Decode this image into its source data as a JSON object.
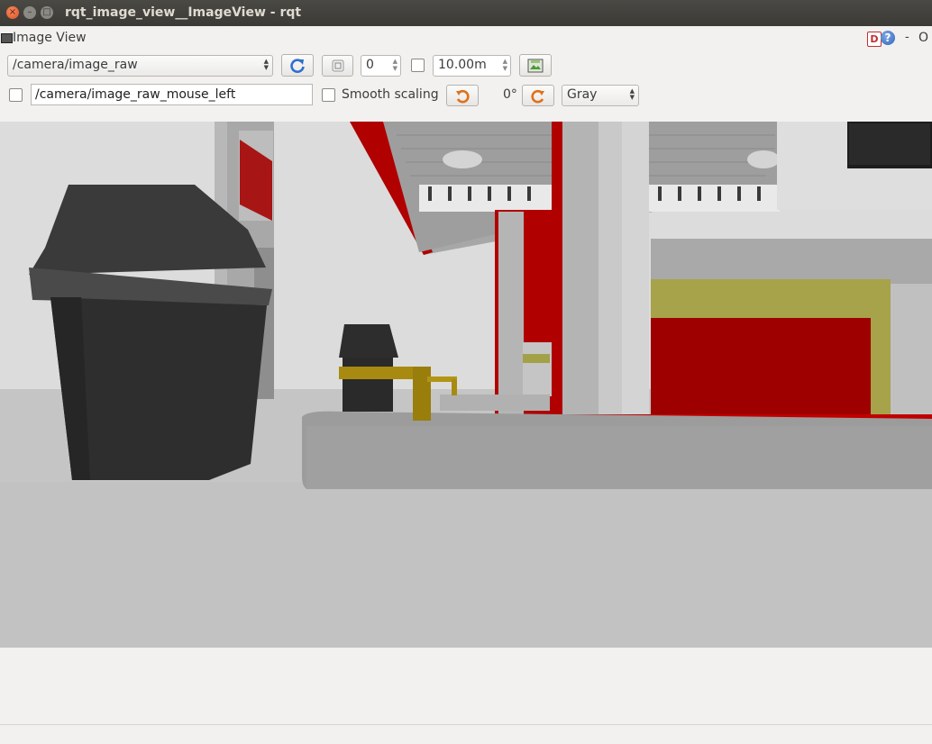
{
  "window": {
    "title": "rqt_image_view__ImageView - rqt"
  },
  "plugin": {
    "title": "Image View",
    "help_letter": "D",
    "help_mark": "?",
    "dash": "-",
    "close": "O"
  },
  "toolbar": {
    "topic": "/camera/image_raw",
    "frame_value": "0",
    "timeout_value": "10.00m",
    "mouse_topic": "/camera/image_raw_mouse_left",
    "smooth_scaling_label": "Smooth scaling",
    "rotation_value": "0°",
    "color_scheme": "Gray"
  },
  "icons": {
    "refresh": "refresh-icon",
    "zoom": "zoom-fit-icon",
    "save": "save-image-icon",
    "rotate_left": "rotate-left-icon",
    "rotate_right": "rotate-right-icon"
  },
  "colors": {
    "accent_red": "#b01010",
    "refresh_blue": "#2f6fd0",
    "rotate_orange": "#e0701a"
  }
}
